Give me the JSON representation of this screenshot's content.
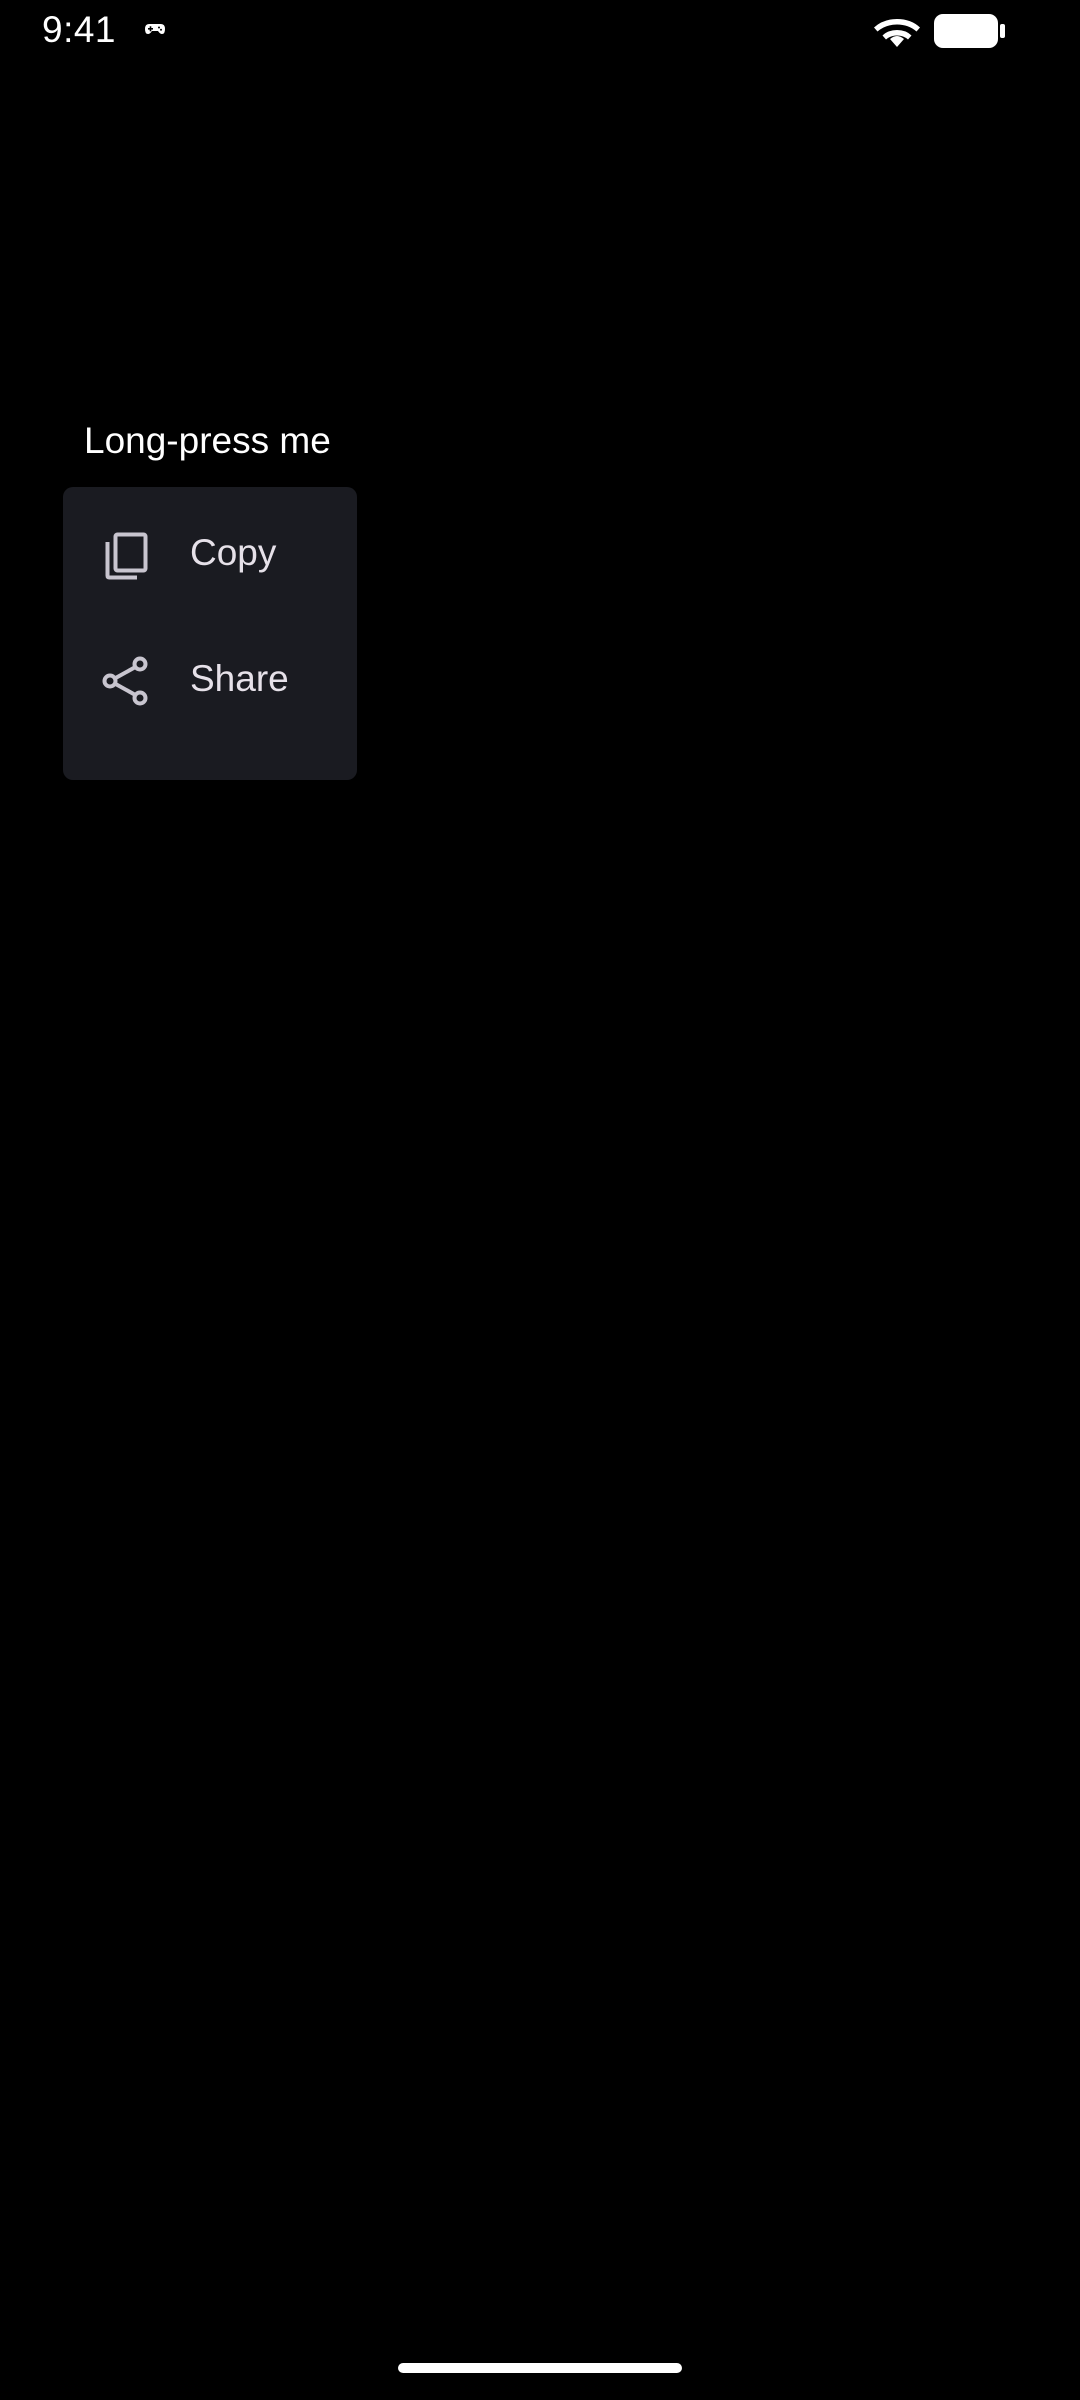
{
  "status_bar": {
    "time": "9:41",
    "notification_icon": "game-controller-icon",
    "wifi_icon": "wifi-icon",
    "battery_icon": "battery-icon"
  },
  "main": {
    "long_press_label": "Long-press me"
  },
  "context_menu": {
    "items": [
      {
        "label": "Copy",
        "icon": "copy-icon"
      },
      {
        "label": "Share",
        "icon": "share-icon"
      }
    ]
  },
  "colors": {
    "background": "#000000",
    "menu_surface": "#1a1b21",
    "menu_text": "#e6e1e9",
    "menu_icon": "#c8c5cf"
  }
}
